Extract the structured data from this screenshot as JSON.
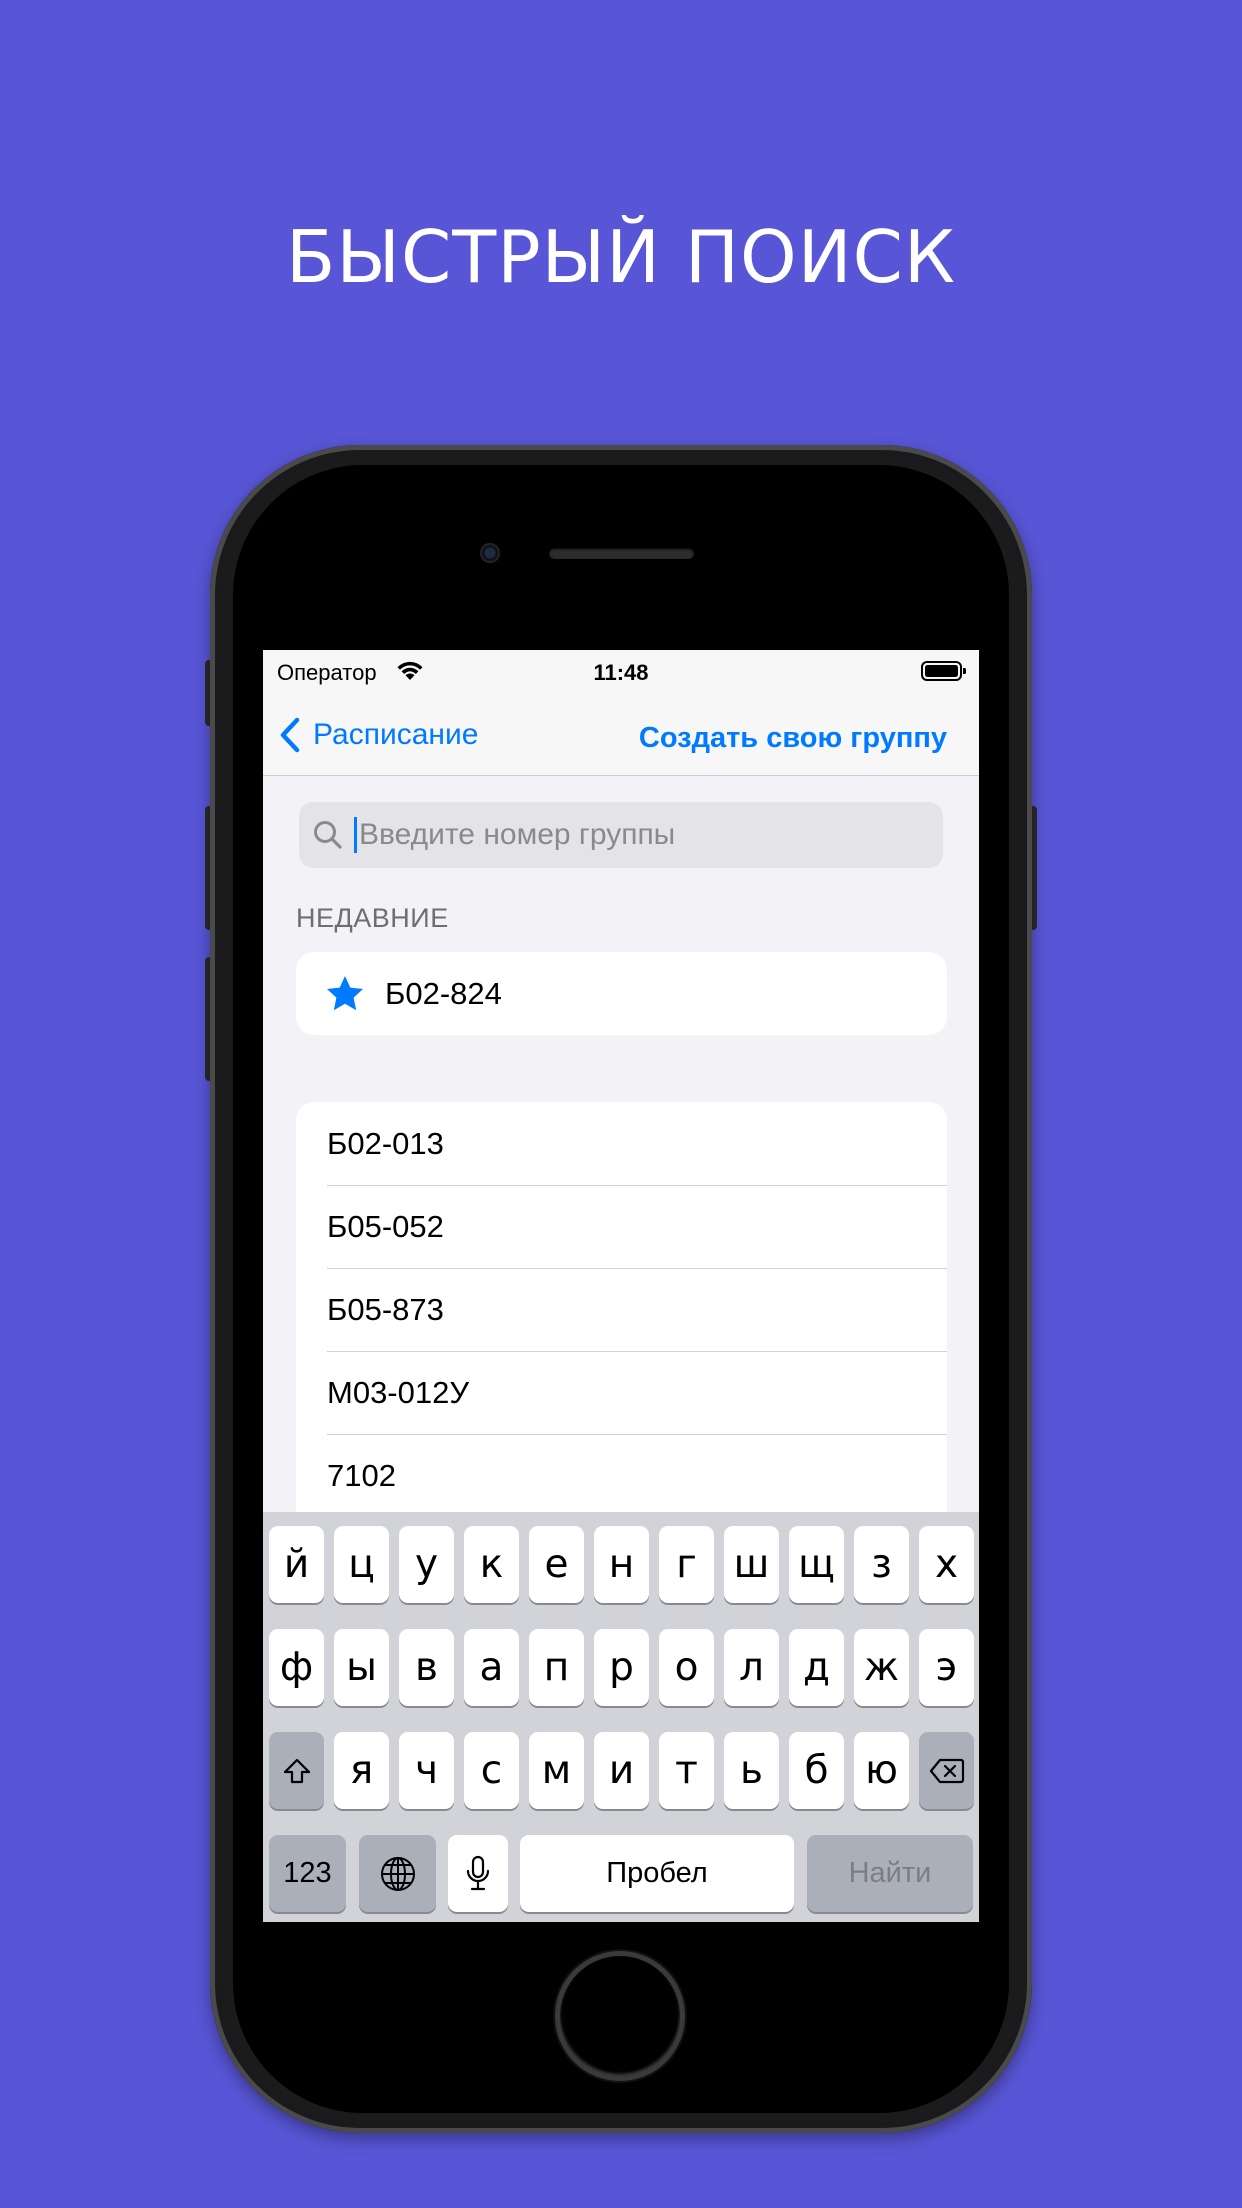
{
  "promo": {
    "headline": "БЫСТРЫЙ ПОИСК",
    "background_color": "#5856D6"
  },
  "status_bar": {
    "carrier": "Оператор",
    "time": "11:48"
  },
  "nav": {
    "back_label": "Расписание",
    "action_label": "Создать свою группу",
    "accent_color": "#007AFF"
  },
  "search": {
    "value": "",
    "placeholder": "Введите номер группы"
  },
  "recent": {
    "header": "НЕДАВНИЕ",
    "items": [
      {
        "label": "Б02-824",
        "icon": "star-icon"
      }
    ]
  },
  "groups": {
    "items": [
      "Б02-013",
      "Б05-052",
      "Б05-873",
      "М03-012У",
      "7102"
    ]
  },
  "keyboard": {
    "row1": [
      "й",
      "ц",
      "у",
      "к",
      "е",
      "н",
      "г",
      "ш",
      "щ",
      "з",
      "х"
    ],
    "row2": [
      "ф",
      "ы",
      "в",
      "а",
      "п",
      "р",
      "о",
      "л",
      "д",
      "ж",
      "э"
    ],
    "row3": [
      "я",
      "ч",
      "с",
      "м",
      "и",
      "т",
      "ь",
      "б",
      "ю"
    ],
    "numbers_label": "123",
    "space_label": "Пробел",
    "return_label": "Найти"
  }
}
